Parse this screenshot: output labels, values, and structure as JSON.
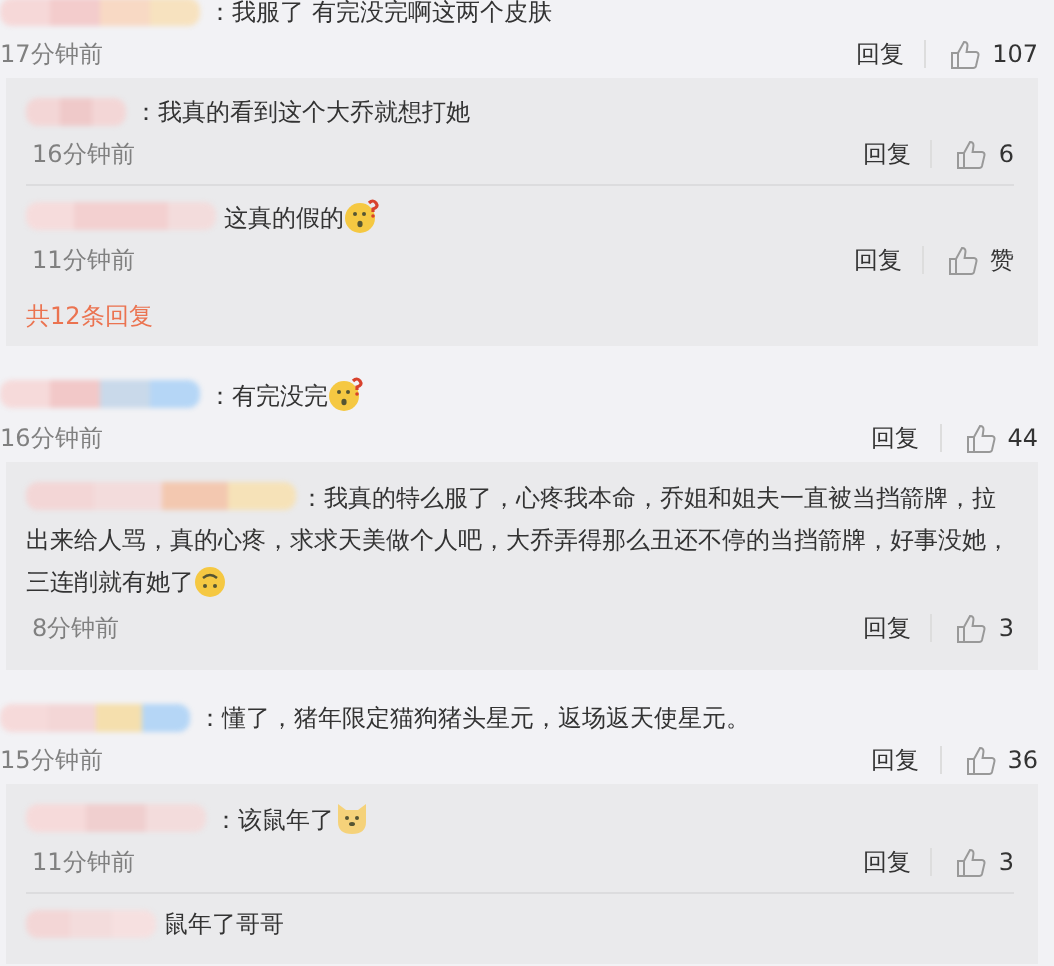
{
  "comments": [
    {
      "text": "：我服了 有完没完啊这两个皮肤",
      "time": "17分钟前",
      "reply_label": "回复",
      "likes": "107",
      "replies": [
        {
          "text": "：我真的看到这个大乔就想打她",
          "time": "16分钟前",
          "reply_label": "回复",
          "likes": "6"
        },
        {
          "text": "这真的假的",
          "emoji": {
            "kind": "surprised"
          },
          "time": "11分钟前",
          "reply_label": "回复",
          "likes": "赞"
        }
      ],
      "more": "共12条回复"
    },
    {
      "text": "：有完没完",
      "emoji": {
        "kind": "surprised"
      },
      "time": "16分钟前",
      "reply_label": "回复",
      "likes": "44",
      "replies": [
        {
          "text": "：我真的特么服了，心疼我本命，乔姐和姐夫一直被当挡箭牌，拉出来给人骂，真的心疼，求求天美做个人吧，大乔弄得那么丑还不停的当挡箭牌，好事没她，三连削就有她了",
          "emoji": {
            "kind": "upside"
          },
          "time": "8分钟前",
          "reply_label": "回复",
          "likes": "3"
        }
      ]
    },
    {
      "text": "：懂了，猪年限定猫狗猪头星元，返场返天使星元。",
      "time": "15分钟前",
      "reply_label": "回复",
      "likes": "36",
      "replies": [
        {
          "text": "：该鼠年了",
          "emoji": {
            "kind": "dog"
          },
          "time": "11分钟前",
          "reply_label": "回复",
          "likes": "3"
        },
        {
          "text": "鼠年了哥哥"
        }
      ]
    }
  ]
}
